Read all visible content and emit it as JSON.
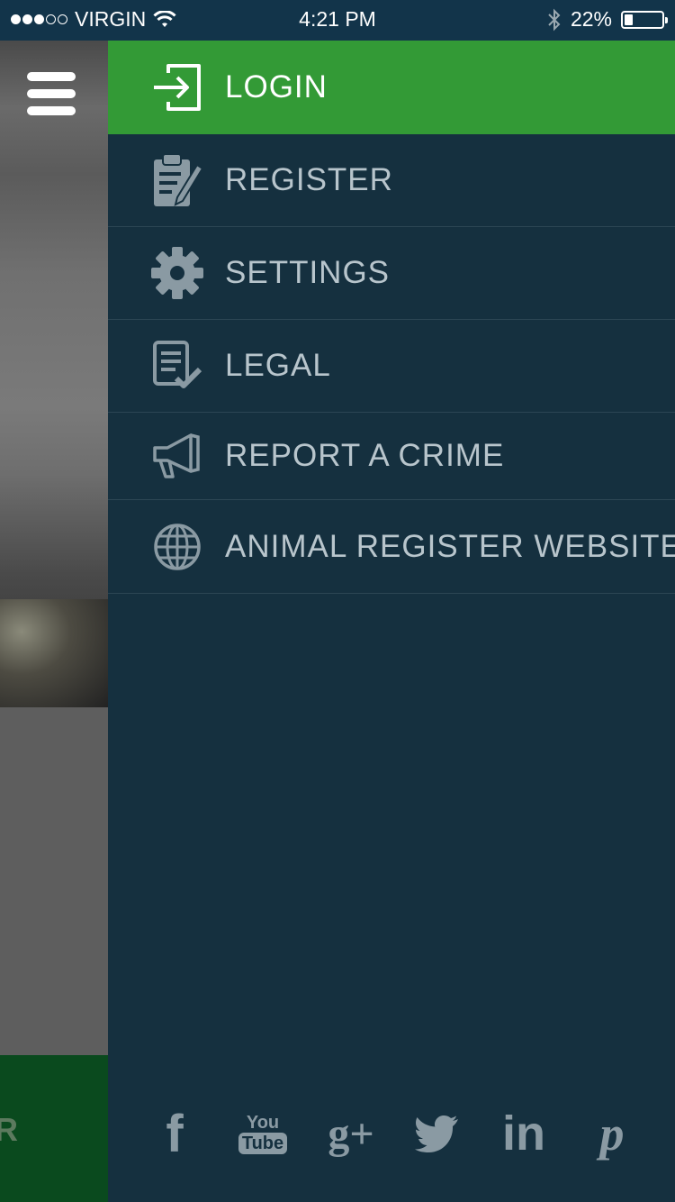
{
  "status_bar": {
    "carrier": "VIRGIN",
    "time": "4:21 PM",
    "battery": "22%",
    "battery_level": 0.22,
    "signal_bars": 3,
    "signal_total": 5
  },
  "background_app": {
    "bottom_button_partial_text": "R"
  },
  "drawer": {
    "items": [
      {
        "label": "LOGIN",
        "icon": "login-icon",
        "active": true
      },
      {
        "label": "REGISTER",
        "icon": "clipboard-icon",
        "active": false
      },
      {
        "label": "SETTINGS",
        "icon": "gear-icon",
        "active": false
      },
      {
        "label": "LEGAL",
        "icon": "document-check-icon",
        "active": false
      },
      {
        "label": "REPORT A CRIME",
        "icon": "megaphone-icon",
        "active": false
      },
      {
        "label": "ANIMAL REGISTER WEBSITE",
        "icon": "globe-icon",
        "active": false
      }
    ],
    "social": [
      {
        "icon": "facebook-icon",
        "text": "f"
      },
      {
        "icon": "youtube-icon",
        "text_top": "You",
        "text_bottom": "Tube"
      },
      {
        "icon": "google-plus-icon",
        "text": "g+"
      },
      {
        "icon": "twitter-icon"
      },
      {
        "icon": "linkedin-icon",
        "text": "in"
      },
      {
        "icon": "pinterest-icon",
        "text": "p"
      }
    ]
  },
  "colors": {
    "accent_green": "#339a36",
    "drawer_bg": "#15303f",
    "status_bar_bg": "#12344a",
    "menu_text": "#b8c5cc",
    "icon_gray": "#8a9aa3"
  }
}
